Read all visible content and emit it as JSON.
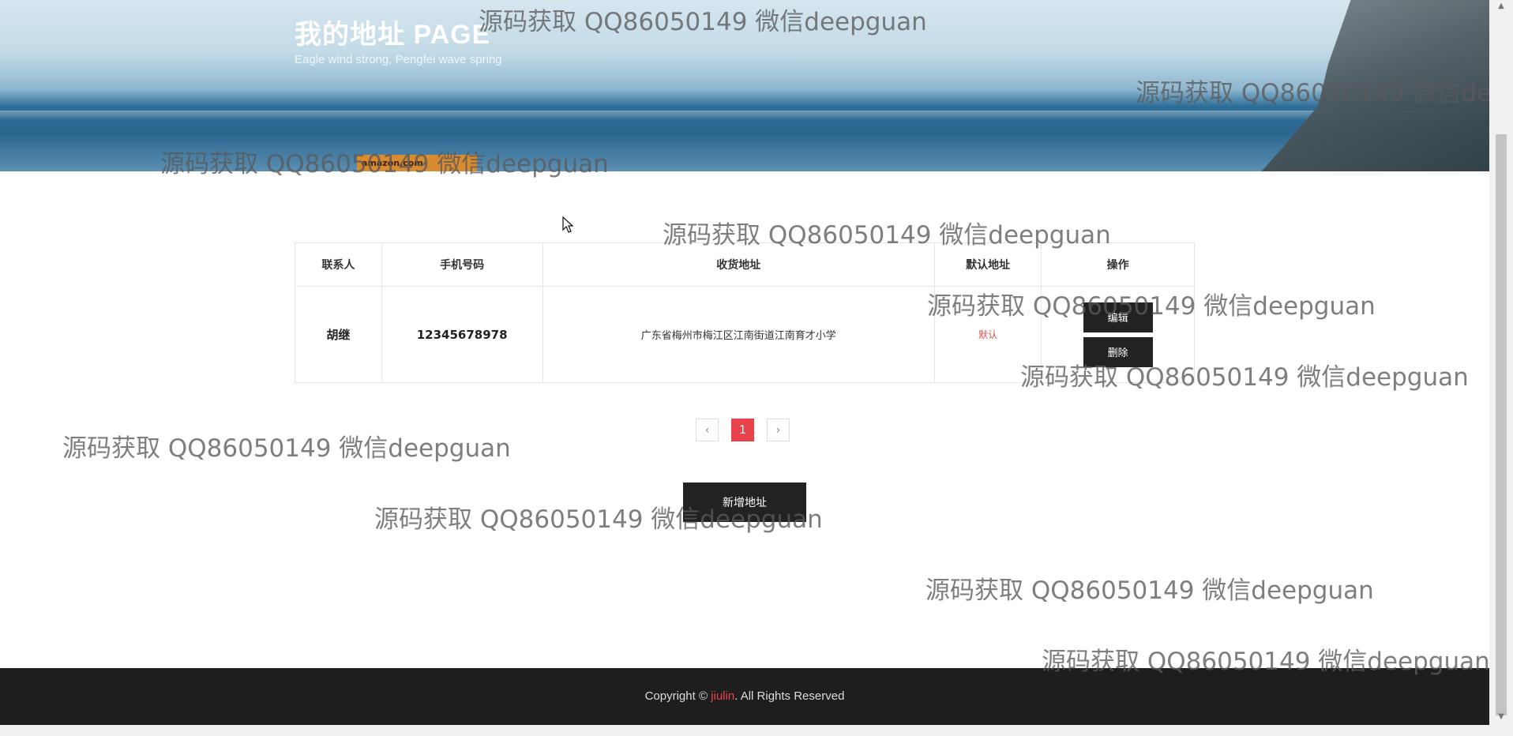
{
  "banner": {
    "title": "我的地址 PAGE",
    "subtitle": "Eagle wind strong, Pengfei wave spring",
    "badge_text": "amazon.com"
  },
  "table": {
    "headers": [
      "联系人",
      "手机号码",
      "收货地址",
      "默认地址",
      "操作"
    ],
    "rows": [
      {
        "name": "胡继",
        "phone": "12345678978",
        "address": "广东省梅州市梅江区江南街道江南育才小学",
        "default_label": "默认",
        "edit_label": "编辑",
        "delete_label": "删除"
      }
    ]
  },
  "pagination": {
    "prev": "‹",
    "current": "1",
    "next": "›"
  },
  "add_button": "新增地址",
  "footer": {
    "prefix": "Copyright © ",
    "brand": "jiulin",
    "suffix": ". All Rights Reserved"
  },
  "watermark_text": "源码获取 QQ86050149 微信deepguan",
  "colors": {
    "accent": "#e8424a",
    "dark_button": "#222222",
    "footer_bg": "#1e1e1e"
  }
}
